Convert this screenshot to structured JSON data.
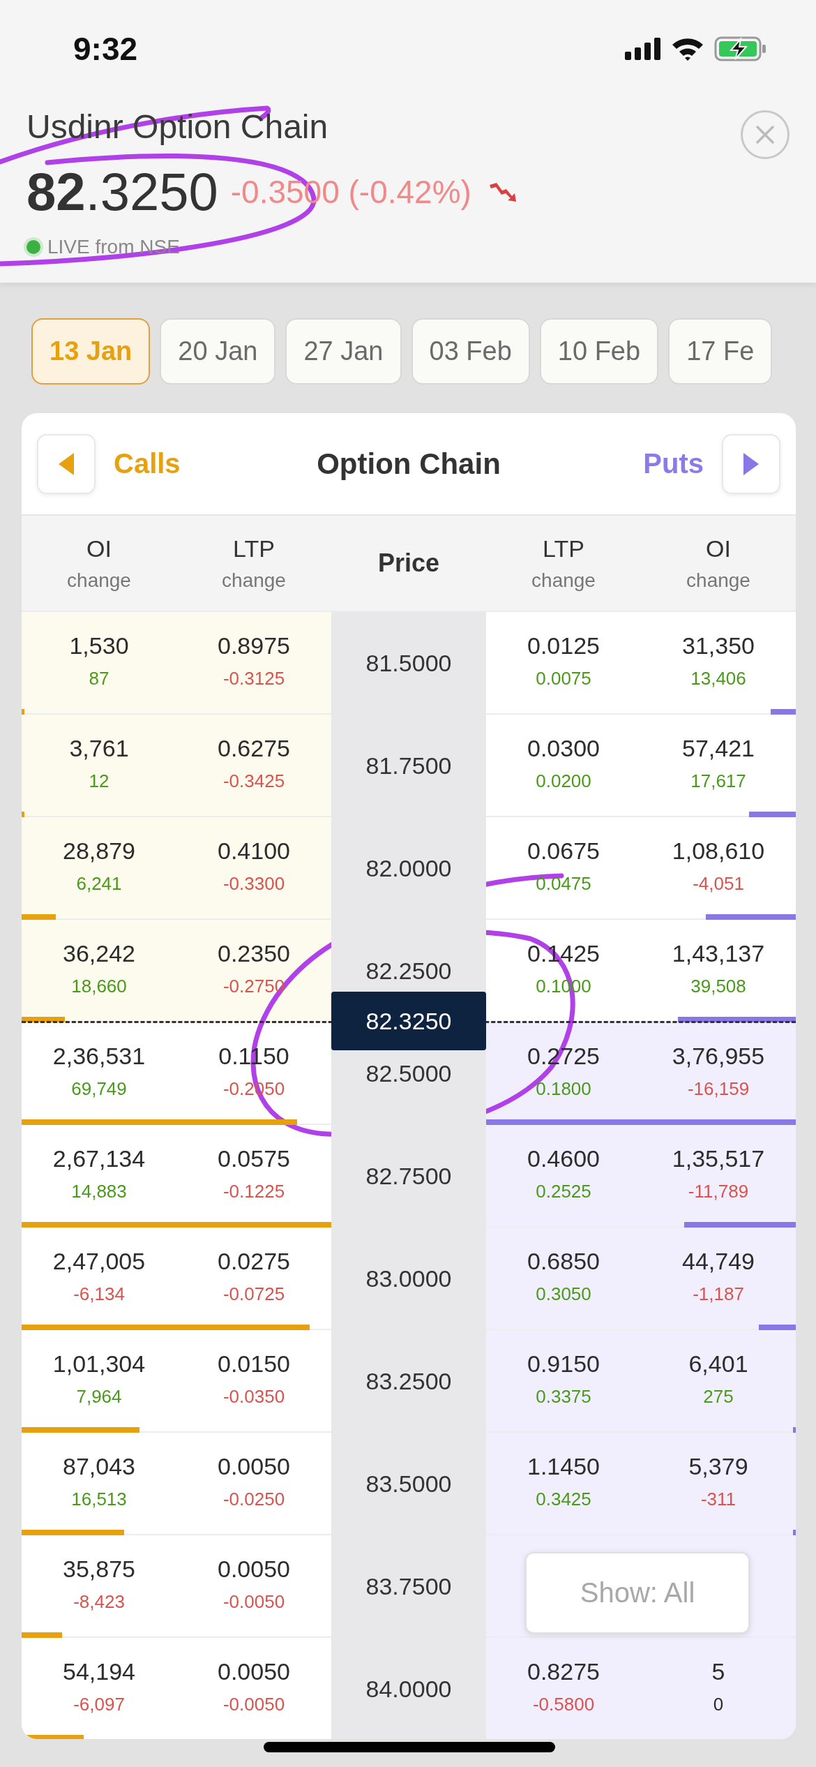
{
  "status_bar": {
    "time": "9:32"
  },
  "header": {
    "title": "Usdinr Option Chain",
    "price": "**82**.3250",
    "change": "-0.3500 (-0.42%)",
    "negative": true,
    "live_label": "LIVE from NSE",
    "live": true
  },
  "expiries": [
    {
      "label": "13 Jan",
      "selected": true
    },
    {
      "label": "20 Jan",
      "selected": false
    },
    {
      "label": "27 Jan",
      "selected": false
    },
    {
      "label": "03 Feb",
      "selected": false
    },
    {
      "label": "10 Feb",
      "selected": false
    },
    {
      "label": "17 Fe",
      "selected": false
    }
  ],
  "chain": {
    "title": "Option Chain",
    "calls_label": "Calls",
    "puts_label": "Puts",
    "columns": [
      {
        "label": "OI",
        "sublabel": "change"
      },
      {
        "label": "LTP",
        "sublabel": "change"
      },
      {
        "label": "Price"
      },
      {
        "label": "LTP",
        "sublabel": "change"
      },
      {
        "label": "OI",
        "sublabel": "change"
      }
    ],
    "spot_price": "82.3250",
    "rows": [
      {
        "strike": "81.5000",
        "spot_above": false,
        "call": {
          "itm": true,
          "level": 0.01,
          "oi": "1,530",
          "oi_change": {
            "text": "87",
            "positive": true,
            "negative": false
          },
          "ltp": "0.8975",
          "ltp_change": {
            "text": "-0.3125",
            "positive": false,
            "negative": true
          }
        },
        "put": {
          "itm": false,
          "level": 0.08,
          "ltp": "0.0125",
          "ltp_change": {
            "text": "0.0075",
            "positive": true,
            "negative": false
          },
          "oi": "31,350",
          "oi_change": {
            "text": "13,406",
            "positive": true,
            "negative": false
          }
        }
      },
      {
        "strike": "81.7500",
        "spot_above": false,
        "call": {
          "itm": true,
          "level": 0.01,
          "oi": "3,761",
          "oi_change": {
            "text": "12",
            "positive": true,
            "negative": false
          },
          "ltp": "0.6275",
          "ltp_change": {
            "text": "-0.3425",
            "positive": false,
            "negative": true
          }
        },
        "put": {
          "itm": false,
          "level": 0.15,
          "ltp": "0.0300",
          "ltp_change": {
            "text": "0.0200",
            "positive": true,
            "negative": false
          },
          "oi": "57,421",
          "oi_change": {
            "text": "17,617",
            "positive": true,
            "negative": false
          }
        }
      },
      {
        "strike": "82.0000",
        "spot_above": false,
        "call": {
          "itm": true,
          "level": 0.11,
          "oi": "28,879",
          "oi_change": {
            "text": "6,241",
            "positive": true,
            "negative": false
          },
          "ltp": "0.4100",
          "ltp_change": {
            "text": "-0.3300",
            "positive": false,
            "negative": true
          }
        },
        "put": {
          "itm": false,
          "level": 0.29,
          "ltp": "0.0675",
          "ltp_change": {
            "text": "0.0475",
            "positive": true,
            "negative": false
          },
          "oi": "1,08,610",
          "oi_change": {
            "text": "-4,051",
            "positive": false,
            "negative": true
          }
        }
      },
      {
        "strike": "82.2500",
        "spot_above": false,
        "call": {
          "itm": true,
          "level": 0.14,
          "oi": "36,242",
          "oi_change": {
            "text": "18,660",
            "positive": true,
            "negative": false
          },
          "ltp": "0.2350",
          "ltp_change": {
            "text": "-0.2750",
            "positive": false,
            "negative": true
          }
        },
        "put": {
          "itm": false,
          "level": 0.38,
          "ltp": "0.1425",
          "ltp_change": {
            "text": "0.1000",
            "positive": true,
            "negative": false
          },
          "oi": "1,43,137",
          "oi_change": {
            "text": "39,508",
            "positive": true,
            "negative": false
          }
        }
      },
      {
        "strike": "82.5000",
        "spot_above": true,
        "call": {
          "itm": false,
          "level": 0.89,
          "oi": "2,36,531",
          "oi_change": {
            "text": "69,749",
            "positive": true,
            "negative": false
          },
          "ltp": "0.1150",
          "ltp_change": {
            "text": "-0.2050",
            "positive": false,
            "negative": true
          }
        },
        "put": {
          "itm": true,
          "level": 1,
          "ltp": "0.2725",
          "ltp_change": {
            "text": "0.1800",
            "positive": true,
            "negative": false
          },
          "oi": "3,76,955",
          "oi_change": {
            "text": "-16,159",
            "positive": false,
            "negative": true
          }
        }
      },
      {
        "strike": "82.7500",
        "spot_above": false,
        "call": {
          "itm": false,
          "level": 1,
          "oi": "2,67,134",
          "oi_change": {
            "text": "14,883",
            "positive": true,
            "negative": false
          },
          "ltp": "0.0575",
          "ltp_change": {
            "text": "-0.1225",
            "positive": false,
            "negative": true
          }
        },
        "put": {
          "itm": true,
          "level": 0.36,
          "ltp": "0.4600",
          "ltp_change": {
            "text": "0.2525",
            "positive": true,
            "negative": false
          },
          "oi": "1,35,517",
          "oi_change": {
            "text": "-11,789",
            "positive": false,
            "negative": true
          }
        }
      },
      {
        "strike": "83.0000",
        "spot_above": false,
        "call": {
          "itm": false,
          "level": 0.93,
          "oi": "2,47,005",
          "oi_change": {
            "text": "-6,134",
            "positive": false,
            "negative": true
          },
          "ltp": "0.0275",
          "ltp_change": {
            "text": "-0.0725",
            "positive": false,
            "negative": true
          }
        },
        "put": {
          "itm": true,
          "level": 0.12,
          "ltp": "0.6850",
          "ltp_change": {
            "text": "0.3050",
            "positive": true,
            "negative": false
          },
          "oi": "44,749",
          "oi_change": {
            "text": "-1,187",
            "positive": false,
            "negative": true
          }
        }
      },
      {
        "strike": "83.2500",
        "spot_above": false,
        "call": {
          "itm": false,
          "level": 0.38,
          "oi": "1,01,304",
          "oi_change": {
            "text": "7,964",
            "positive": true,
            "negative": false
          },
          "ltp": "0.0150",
          "ltp_change": {
            "text": "-0.0350",
            "positive": false,
            "negative": true
          }
        },
        "put": {
          "itm": true,
          "level": 0.01,
          "ltp": "0.9150",
          "ltp_change": {
            "text": "0.3375",
            "positive": true,
            "negative": false
          },
          "oi": "6,401",
          "oi_change": {
            "text": "275",
            "positive": true,
            "negative": false
          }
        }
      },
      {
        "strike": "83.5000",
        "spot_above": false,
        "call": {
          "itm": false,
          "level": 0.33,
          "oi": "87,043",
          "oi_change": {
            "text": "16,513",
            "positive": true,
            "negative": false
          },
          "ltp": "0.0050",
          "ltp_change": {
            "text": "-0.0250",
            "positive": false,
            "negative": true
          }
        },
        "put": {
          "itm": true,
          "level": 0.01,
          "ltp": "1.1450",
          "ltp_change": {
            "text": "0.3425",
            "positive": true,
            "negative": false
          },
          "oi": "5,379",
          "oi_change": {
            "text": "-311",
            "positive": false,
            "negative": true
          }
        }
      },
      {
        "strike": "83.7500",
        "spot_above": false,
        "call": {
          "itm": false,
          "level": 0.13,
          "oi": "35,875",
          "oi_change": {
            "text": "-8,423",
            "positive": false,
            "negative": true
          },
          "ltp": "0.0050",
          "ltp_change": {
            "text": "-0.0050",
            "positive": false,
            "negative": true
          }
        },
        "put": {
          "itm": true
        }
      },
      {
        "strike": "84.0000",
        "spot_above": false,
        "call": {
          "itm": false,
          "level": 0.2,
          "oi": "54,194",
          "oi_change": {
            "text": "-6,097",
            "positive": false,
            "negative": true
          },
          "ltp": "0.0050",
          "ltp_change": {
            "text": "-0.0050",
            "positive": false,
            "negative": true
          }
        },
        "put": {
          "itm": true,
          "ltp": "0.8275",
          "ltp_change": {
            "text": "-0.5800",
            "positive": false,
            "negative": true
          },
          "oi": "5",
          "oi_change": {
            "text": "0",
            "positive": false,
            "negative": false
          }
        }
      }
    ],
    "filter_button": {
      "label": "Show: All"
    }
  }
}
